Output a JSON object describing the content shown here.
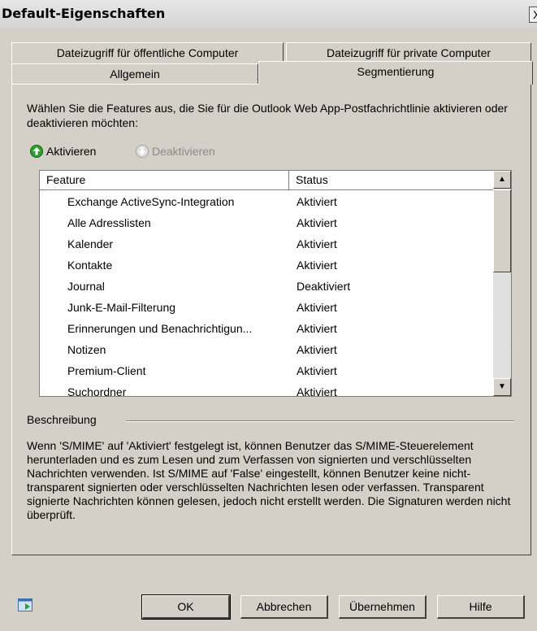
{
  "window": {
    "title": "Default-Eigenschaften",
    "close": "X"
  },
  "tabs": {
    "row1": [
      "Dateizugriff für öffentliche Computer",
      "Dateizugriff für private Computer"
    ],
    "row2": [
      "Allgemein",
      "Segmentierung"
    ],
    "selected": "Segmentierung"
  },
  "intro": "Wählen Sie die Features aus, die Sie für die Outlook Web App-Postfachrichtlinie aktivieren oder deaktivieren möchten:",
  "actions": {
    "enable": "Aktivieren",
    "disable": "Deaktivieren"
  },
  "list": {
    "columns": [
      "Feature",
      "Status"
    ],
    "rows": [
      {
        "feature": "Exchange ActiveSync-Integration",
        "status": "Aktiviert"
      },
      {
        "feature": "Alle Adresslisten",
        "status": "Aktiviert"
      },
      {
        "feature": "Kalender",
        "status": "Aktiviert"
      },
      {
        "feature": "Kontakte",
        "status": "Aktiviert"
      },
      {
        "feature": "Journal",
        "status": "Deaktiviert"
      },
      {
        "feature": "Junk-E-Mail-Filterung",
        "status": "Aktiviert"
      },
      {
        "feature": "Erinnerungen und Benachrichtigun...",
        "status": "Aktiviert"
      },
      {
        "feature": "Notizen",
        "status": "Aktiviert"
      },
      {
        "feature": "Premium-Client",
        "status": "Aktiviert"
      },
      {
        "feature": "Suchordner",
        "status": "Aktiviert"
      }
    ]
  },
  "description": {
    "label": "Beschreibung",
    "text": "Wenn 'S/MIME' auf 'Aktiviert' festgelegt ist, können Benutzer das S/MIME-Steuerelement herunterladen und es zum Lesen und zum Verfassen von signierten und verschlüsselten Nachrichten verwenden. Ist S/MIME auf 'False' eingestellt, können Benutzer keine nicht-transparent signierten oder verschlüsselten Nachrichten lesen oder verfassen. Transparent signierte Nachrichten können gelesen, jedoch nicht erstellt werden. Die Signaturen werden nicht überprüft."
  },
  "buttons": {
    "ok": "OK",
    "cancel": "Abbrechen",
    "apply": "Übernehmen",
    "help": "Hilfe"
  },
  "colors": {
    "enable_icon": "#2e9e2e",
    "disabled_text": "#8a8a8a"
  }
}
